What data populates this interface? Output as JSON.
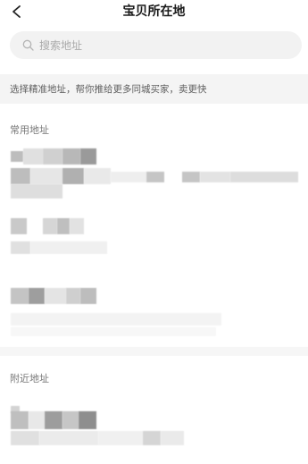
{
  "header": {
    "title": "宝贝所在地",
    "back_icon": "chevron-left-icon"
  },
  "search": {
    "placeholder": "搜索地址",
    "icon": "search-icon"
  },
  "tip": {
    "text": "选择精准地址，帮你推给更多同城买家，卖更快"
  },
  "sections": {
    "common": {
      "title": "常用地址"
    },
    "nearby": {
      "title": "附近地址"
    }
  },
  "colors": {
    "background": "#ffffff",
    "tip_background": "#f4f4f4",
    "search_background": "#f2f2f2",
    "section_title": "#777777"
  }
}
